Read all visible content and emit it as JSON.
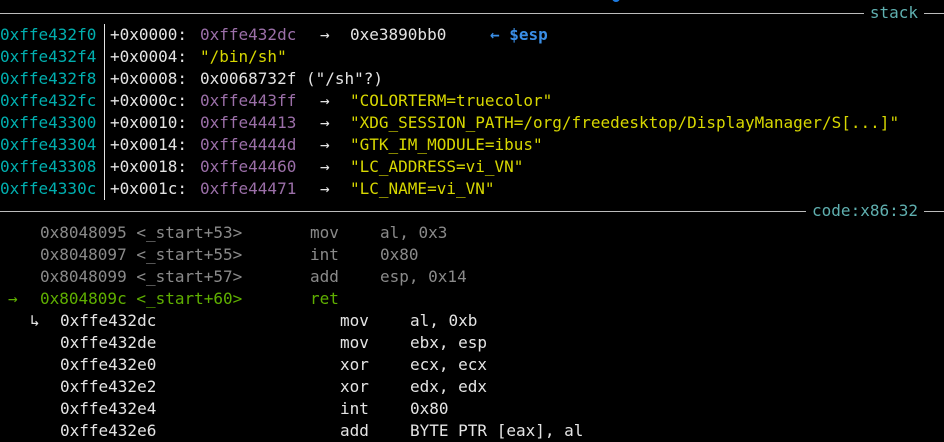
{
  "stack_label": "stack",
  "code_label": "code:x86:32",
  "colors": {
    "address": "#00afaf",
    "pointer": "#9b6fa8",
    "string": "#d7d700",
    "marker": "#3a8ee6",
    "past": "#8a8a8a",
    "current": "#5faf00"
  },
  "stack_rows": [
    {
      "addr": "0xffe432f0",
      "offset": "+0x0000:",
      "value": "0xffe432dc",
      "arrow": "→",
      "deref": "0xe3890bb0",
      "marker": "← $esp"
    },
    {
      "addr": "0xffe432f4",
      "offset": "+0x0004:",
      "value": "\"/bin/sh\"",
      "arrow": "",
      "deref": "",
      "marker": ""
    },
    {
      "addr": "0xffe432f8",
      "offset": "+0x0008:",
      "value": "0x0068732f (\"/sh\"?)",
      "arrow": "",
      "deref": "",
      "marker": ""
    },
    {
      "addr": "0xffe432fc",
      "offset": "+0x000c:",
      "value": "0xffe443ff",
      "arrow": "→",
      "deref": "\"COLORTERM=truecolor\"",
      "marker": ""
    },
    {
      "addr": "0xffe43300",
      "offset": "+0x0010:",
      "value": "0xffe44413",
      "arrow": "→",
      "deref": "\"XDG_SESSION_PATH=/org/freedesktop/DisplayManager/S[...]\"",
      "marker": ""
    },
    {
      "addr": "0xffe43304",
      "offset": "+0x0014:",
      "value": "0xffe4444d",
      "arrow": "→",
      "deref": "\"GTK_IM_MODULE=ibus\"",
      "marker": ""
    },
    {
      "addr": "0xffe43308",
      "offset": "+0x0018:",
      "value": "0xffe44460",
      "arrow": "→",
      "deref": "\"LC_ADDRESS=vi_VN\"",
      "marker": ""
    },
    {
      "addr": "0xffe4330c",
      "offset": "+0x001c:",
      "value": "0xffe44471",
      "arrow": "→",
      "deref": "\"LC_NAME=vi_VN\"",
      "marker": ""
    }
  ],
  "code_rows": [
    {
      "prefix": "",
      "addr": "0x8048095 <_start+53>",
      "mnemonic": "mov",
      "operands": "al, 0x3",
      "state": "past"
    },
    {
      "prefix": "",
      "addr": "0x8048097 <_start+55>",
      "mnemonic": "int",
      "operands": "0x80",
      "state": "past"
    },
    {
      "prefix": "",
      "addr": "0x8048099 <_start+57>",
      "mnemonic": "add",
      "operands": "esp, 0x14",
      "state": "past"
    },
    {
      "prefix": "→",
      "addr": "0x804809c <_start+60>",
      "mnemonic": "ret",
      "operands": "",
      "state": "current"
    }
  ],
  "target_rows": [
    {
      "prefix": "↳",
      "addr": "0xffe432dc",
      "mnemonic": "mov",
      "operands": "al, 0xb"
    },
    {
      "prefix": "",
      "addr": "0xffe432de",
      "mnemonic": "mov",
      "operands": "ebx, esp"
    },
    {
      "prefix": "",
      "addr": "0xffe432e0",
      "mnemonic": "xor",
      "operands": "ecx, ecx"
    },
    {
      "prefix": "",
      "addr": "0xffe432e2",
      "mnemonic": "xor",
      "operands": "edx, edx"
    },
    {
      "prefix": "",
      "addr": "0xffe432e4",
      "mnemonic": "int",
      "operands": "0x80"
    },
    {
      "prefix": "",
      "addr": "0xffe432e6",
      "mnemonic": "add",
      "operands": "BYTE PTR [eax], al"
    }
  ]
}
